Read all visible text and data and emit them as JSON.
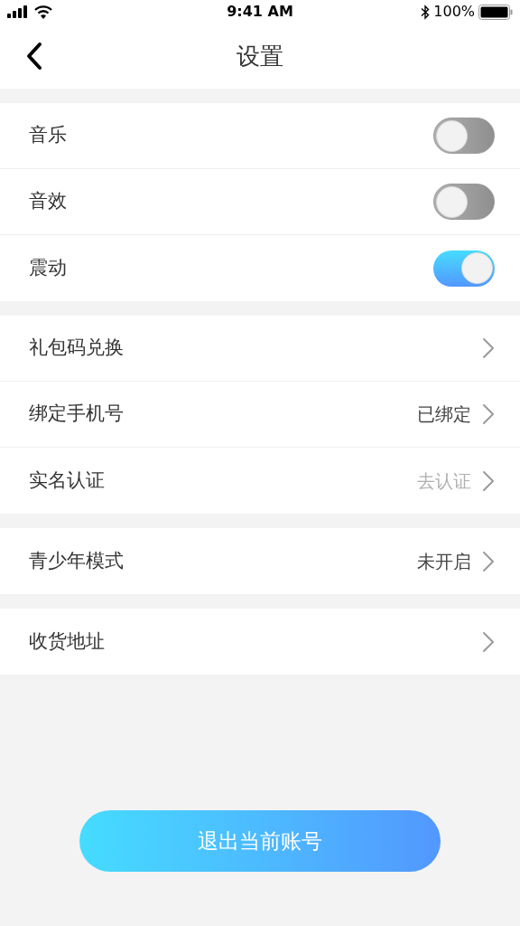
{
  "status_bar": {
    "time": "9:41 AM",
    "battery": "100%"
  },
  "nav": {
    "title": "设置"
  },
  "groups": [
    {
      "rows": [
        {
          "kind": "toggle",
          "label": "音乐",
          "on": false
        },
        {
          "kind": "toggle",
          "label": "音效",
          "on": false
        },
        {
          "kind": "toggle",
          "label": "震动",
          "on": true
        }
      ]
    },
    {
      "rows": [
        {
          "kind": "link",
          "label": "礼包码兑换"
        },
        {
          "kind": "link",
          "label": "绑定手机号",
          "value": "已绑定",
          "dimmed": false
        },
        {
          "kind": "link",
          "label": "实名认证",
          "value": "去认证",
          "dimmed": true
        }
      ]
    },
    {
      "rows": [
        {
          "kind": "link",
          "label": "青少年模式",
          "value": "未开启",
          "dimmed": false
        }
      ]
    },
    {
      "rows": [
        {
          "kind": "link",
          "label": "收货地址"
        }
      ]
    }
  ],
  "logout_button": "退出当前账号"
}
